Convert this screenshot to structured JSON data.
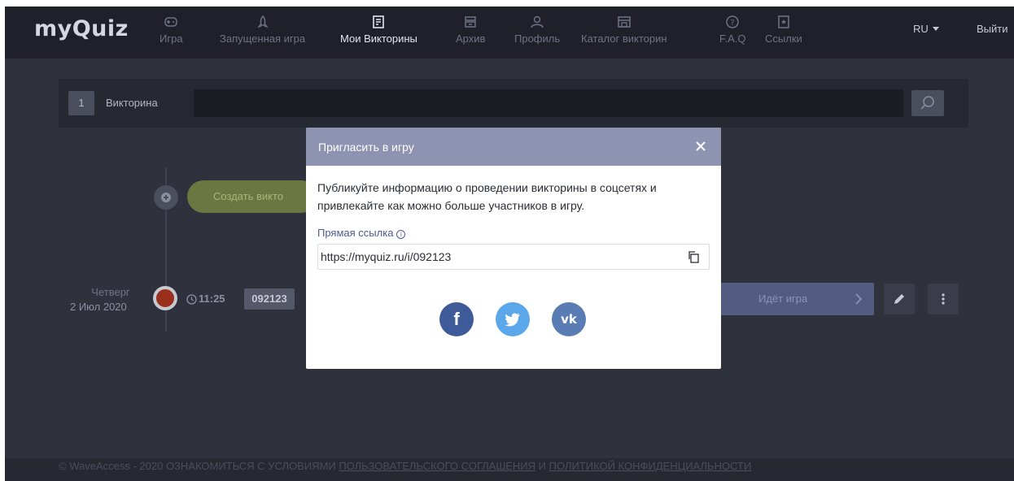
{
  "app": {
    "logo": "myQuiz"
  },
  "nav": {
    "items": [
      {
        "label": "Игра",
        "icon": "gamepad-icon"
      },
      {
        "label": "Запущенная игра",
        "icon": "rocket-icon"
      },
      {
        "label": "Мои Викторины",
        "icon": "document-icon",
        "active": true
      },
      {
        "label": "Архив",
        "icon": "archive-icon"
      },
      {
        "label": "Профиль",
        "icon": "user-icon"
      },
      {
        "label": "Каталог викторин",
        "icon": "store-icon"
      },
      {
        "label": "F.A.Q",
        "icon": "help-icon"
      },
      {
        "label": "Ссылки",
        "icon": "bookmark-icon"
      }
    ],
    "lang": "RU",
    "logout": "Выйти"
  },
  "search": {
    "number": "1",
    "label": "Викторина",
    "value": "",
    "icon": "search-icon"
  },
  "timeline": {
    "create_label": "Создать викто",
    "day": "Четверг",
    "date": "2 Июл 2020",
    "time": "11:25",
    "code": "092123",
    "status": "Идёт игра"
  },
  "modal": {
    "title": "Пригласить в игру",
    "description": "Публикуйте информацию о проведении викторины в соцсетях и привлекайте как можно больше участников в игру.",
    "link_label": "Прямая ссылка",
    "link_value": "https://myquiz.ru/i/092123",
    "social": {
      "facebook": "f",
      "twitter": "twitter-bird-icon",
      "vk": "vk"
    }
  },
  "footer": {
    "copyright": "© WaveAccess - 2020",
    "prefix": "ОЗНАКОМИТЬСЯ С УСЛОВИЯМИ",
    "agreement_link": "ПОЛЬЗОВАТЕЛЬСКОГО СОГЛАШЕНИЯ",
    "and": "И",
    "privacy_link": "ПОЛИТИКОЙ КОНФИДЕНЦИАЛЬНОСТИ"
  },
  "colors": {
    "background": "#2f313d",
    "header": "#1f2029",
    "modal_header": "#8d93b1",
    "accent_green": "#8dbf3c",
    "facebook": "#3f5a99",
    "twitter": "#5ca6ea",
    "vk": "#5a7cb4",
    "live": "#9a2f1c"
  }
}
